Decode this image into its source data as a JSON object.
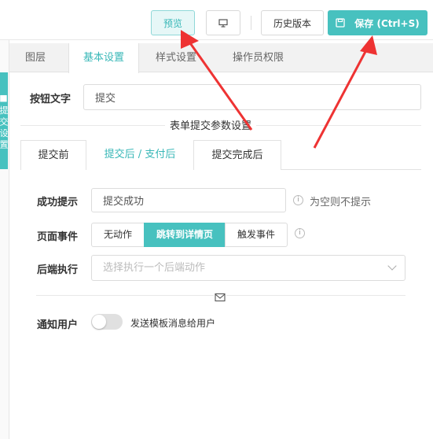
{
  "toolbar": {
    "preview_label": "预览",
    "history_label": "历史版本",
    "save_label": "保存 (Ctrl+S)"
  },
  "left_strip": {
    "text": "■ 提 交 设 置"
  },
  "tabs": [
    "图层",
    "基本设置",
    "样式设置",
    "操作员权限"
  ],
  "button_text": {
    "label": "按钮文字",
    "value": "提交"
  },
  "section_title": "表单提交参数设置",
  "subtabs": [
    "提交前",
    "提交后 / 支付后",
    "提交完成后"
  ],
  "success_tip": {
    "label": "成功提示",
    "value": "提交成功",
    "hint": "为空则不提示"
  },
  "page_event": {
    "label": "页面事件",
    "options": [
      "无动作",
      "跳转到详情页",
      "触发事件"
    ],
    "selected": "跳转到详情页"
  },
  "backend": {
    "label": "后端执行",
    "placeholder": "选择执行一个后端动作"
  },
  "notify": {
    "label": "通知用户",
    "text": "发送模板消息给用户",
    "enabled": false
  },
  "colors": {
    "accent": "#47c1bf",
    "arrow": "#ee3333"
  }
}
